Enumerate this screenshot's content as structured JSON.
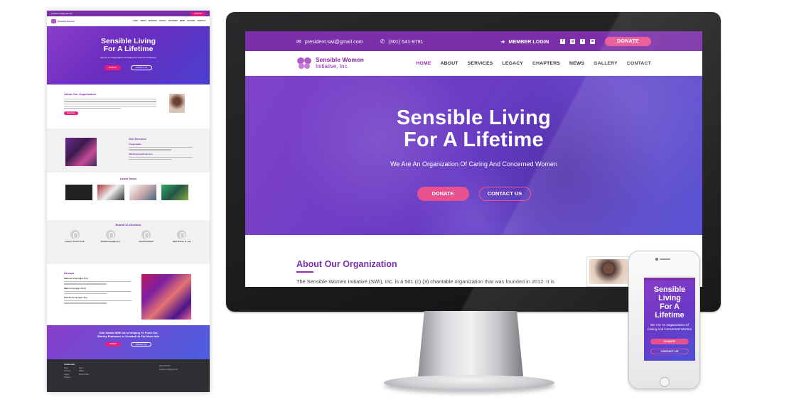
{
  "site": {
    "email": "president.swi@gmail.com",
    "phone": "(301) 541-8791",
    "member_login": "MEMBER LOGIN",
    "donate_top": "DONATE",
    "logo_line1": "Sensible Women",
    "logo_line2": "Initiative, Inc.",
    "nav": [
      "HOME",
      "ABOUT",
      "SERVICES",
      "LEGACY",
      "CHAPTERS",
      "NEWS",
      "GALLERY",
      "CONTACT"
    ],
    "social_icons": [
      "facebook-icon",
      "googleplus-icon",
      "twitter-icon",
      "linkedin-icon"
    ]
  },
  "hero": {
    "title_line1": "Sensible Living",
    "title_line2": "For A Lifetime",
    "subtitle": "We Are An Organization Of Caring And Concerned Women",
    "donate_label": "DONATE",
    "contact_label": "CONTACT US"
  },
  "about": {
    "heading": "About Our Organization",
    "text": "The Sensible Women Initiative (SWI), Inc. is a 501 (c) (3) charitable organization that was founded in 2012.  It is"
  },
  "phone_view": {
    "title_line1": "Sensible",
    "title_line2": "Living",
    "title_line3": "For A",
    "title_line4": "Lifetime",
    "subtitle_line1": "We Are An Organization Of",
    "subtitle_line2": "Caring And Concerned Women",
    "donate_label": "DONATE",
    "contact_label": "CONTACT US"
  },
  "preview": {
    "hero_line1": "Sensible Living",
    "hero_line2": "For A Lifetime",
    "hero_sub": "We Are An Organization Of Caring And Concerned Women",
    "donate": "DONATE",
    "contact": "CONTACT US",
    "about_heading": "About Our Organization",
    "read_more": "Read More",
    "services_heading": "Our Services",
    "service_1": "Change Maker",
    "service_2": "SWI Mental Health Services",
    "news_heading": "Latest News",
    "board_heading": "Board Of Directors",
    "board": [
      "Lesley A. Thornton, Ph.D.",
      "Wiseman Campbell, Esq.",
      "Mary Davis-Newell",
      "Ollies Norman, Sr., Esq."
    ],
    "groups_heading": "Groups",
    "groups": [
      "Diamond Group (ages 8-11)",
      "Wake Group (ages 12-17)",
      "Butterfly Group (ages 18+)"
    ],
    "cta_line1": "Join Hands With Us In Helping To Fund Our",
    "cta_line2": "Worthy Endeavor or Contact Us For More Info",
    "useful_links": "Useful Links",
    "footer_links": [
      "About",
      "Services",
      "Legacy",
      "Chapters",
      "News",
      "Gallery",
      "Privacy Policy"
    ]
  }
}
